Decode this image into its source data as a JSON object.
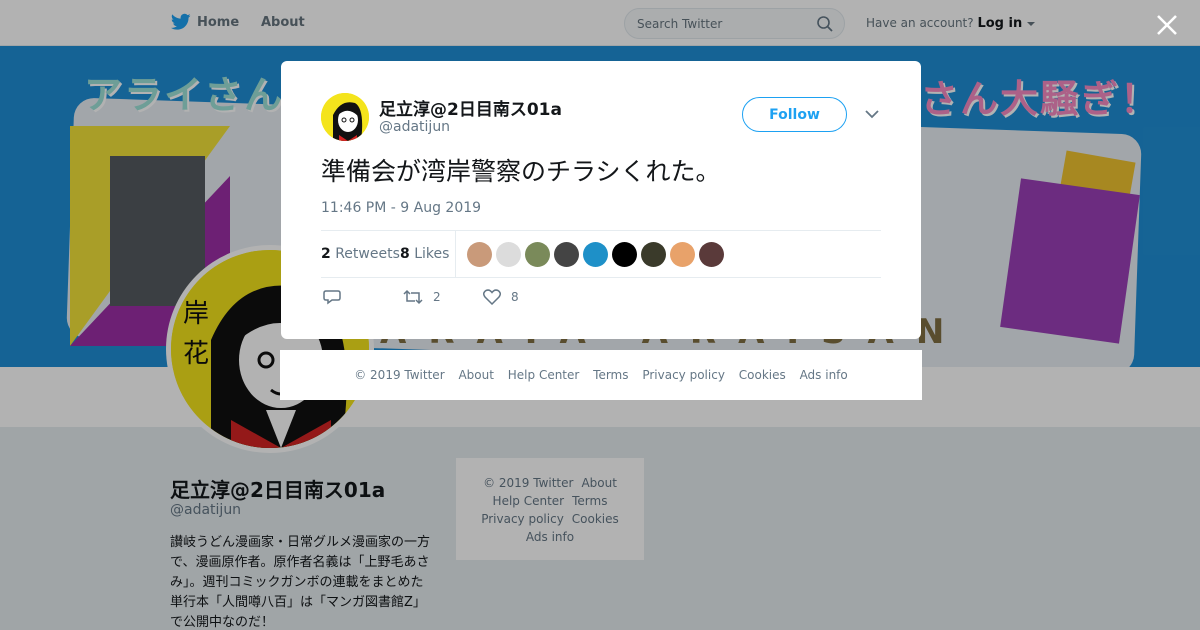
{
  "nav": {
    "home_label": "Home",
    "about_label": "About",
    "search_placeholder": "Search Twitter",
    "account_prompt": "Have an account?",
    "login_label": "Log in"
  },
  "profile": {
    "name": "足立淳@2日目南ス01a",
    "handle": "@adatijun",
    "bio": "讃岐うどん漫画家・日常グルメ漫画家の一方で、漫画原作者。原作者名義は「上野毛あさみ」。週刊コミックガンボの連載をまとめた単行本「人間噂八百」は「マンガ図書館Z」で公開中なのだ！",
    "banner_text_left": "アライさん",
    "banner_text_right": "さん大騒ぎ！",
    "banner_text_bottom": "ARAIA ARAISAN"
  },
  "side_footer": {
    "links": [
      "© 2019 Twitter",
      "About",
      "Help Center",
      "Terms",
      "Privacy policy",
      "Cookies",
      "Ads info"
    ]
  },
  "tweet": {
    "name": "足立淳@2日目南ス01a",
    "handle": "@adatijun",
    "follow_label": "Follow",
    "text": "準備会が湾岸警察のチラシくれた。",
    "timestamp": "11:46 PM - 9 Aug 2019",
    "retweets_count": "2",
    "retweets_label": "Retweets",
    "likes_count": "8",
    "likes_label": "Likes",
    "action_retweet_count": "2",
    "action_like_count": "8",
    "liker_colors": [
      "#c99a7a",
      "#dcdcdc",
      "#7a8a5a",
      "#444444",
      "#1e90c8",
      "#000000",
      "#3a3a2a",
      "#e8a26a",
      "#5a3a3a"
    ]
  },
  "footer": {
    "links": [
      "© 2019 Twitter",
      "About",
      "Help Center",
      "Terms",
      "Privacy policy",
      "Cookies",
      "Ads info"
    ]
  },
  "colors": {
    "accent": "#1da1f2",
    "banner": "#1f8fd6"
  }
}
